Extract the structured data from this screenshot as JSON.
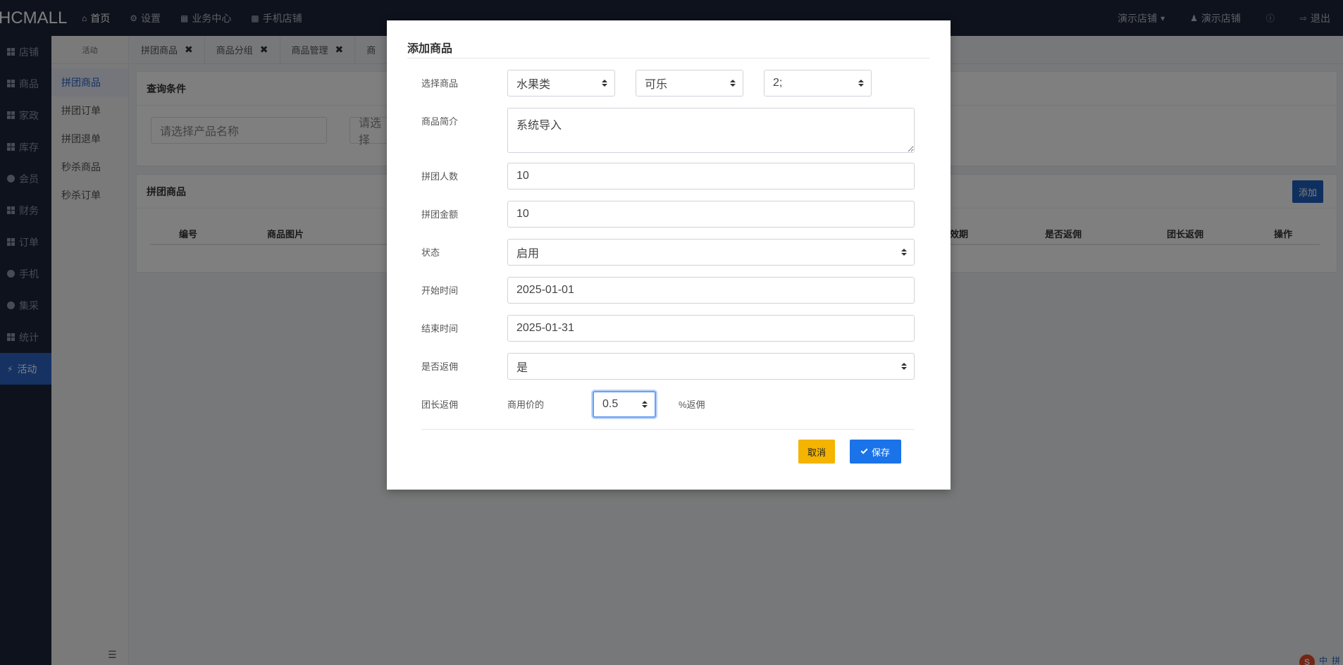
{
  "topbar": {
    "brand": "HCMALL",
    "nav": [
      {
        "label": "首页",
        "icon": "home-icon"
      },
      {
        "label": "设置",
        "icon": "gear-icon"
      },
      {
        "label": "业务中心",
        "icon": "calculator-icon"
      },
      {
        "label": "手机店铺",
        "icon": "qrcode-icon"
      }
    ],
    "right": [
      {
        "label": "演示店铺"
      },
      {
        "label": "演示店铺"
      },
      {
        "label": "退出"
      }
    ]
  },
  "sidebar": {
    "items": [
      {
        "label": "店铺"
      },
      {
        "label": "商品"
      },
      {
        "label": "家政"
      },
      {
        "label": "库存"
      },
      {
        "label": "会员"
      },
      {
        "label": "财务"
      },
      {
        "label": "订单"
      },
      {
        "label": "手机"
      },
      {
        "label": "集采"
      },
      {
        "label": "统计"
      },
      {
        "label": "活动"
      }
    ]
  },
  "subbar": {
    "head": "活动",
    "items": [
      {
        "label": "拼团商品"
      },
      {
        "label": "拼团订单"
      },
      {
        "label": "拼团退单"
      },
      {
        "label": "秒杀商品"
      },
      {
        "label": "秒杀订单"
      }
    ]
  },
  "tabs": [
    {
      "label": "拼团商品"
    },
    {
      "label": "商品分组"
    },
    {
      "label": "商品管理"
    },
    {
      "label": "商"
    }
  ],
  "query": {
    "title": "查询条件",
    "product_placeholder": "请选择产品名称",
    "second_placeholder": "请选择"
  },
  "list": {
    "title": "拼团商品",
    "add_label": "添加",
    "columns": [
      "编号",
      "商品图片",
      "效期",
      "是否返佣",
      "团长返佣",
      "操作"
    ]
  },
  "modal": {
    "title": "添加商品",
    "fields": {
      "product_label": "选择商品",
      "category_value": "水果类",
      "product_value": "可乐",
      "spec_value": "2;",
      "intro_label": "商品简介",
      "intro_value": "系统导入",
      "people_label": "拼团人数",
      "people_value": "10",
      "amount_label": "拼团金额",
      "amount_value": "10",
      "status_label": "状态",
      "status_value": "启用",
      "start_label": "开始时间",
      "start_value": "2025-01-01",
      "end_label": "结束时间",
      "end_value": "2025-01-31",
      "rebate_label": "是否返佣",
      "rebate_value": "是",
      "leader_label": "团长返佣",
      "leader_prefix": "商用价的",
      "leader_value": "0.5",
      "leader_suffix": "%返佣"
    },
    "cancel_label": "取消",
    "save_label": "保存"
  },
  "tray": {
    "items": [
      "中",
      "拼"
    ]
  }
}
